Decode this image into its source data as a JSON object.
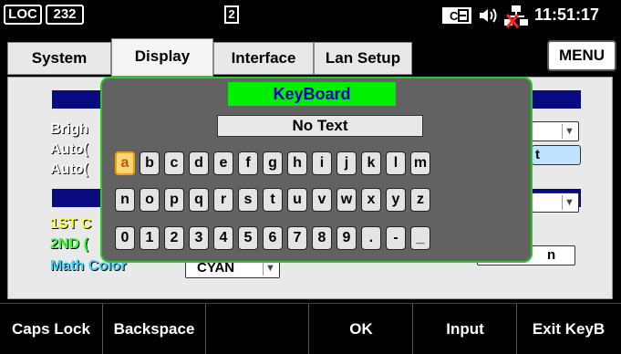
{
  "status": {
    "loc": "LOC",
    "addr": "232",
    "page_indicator": "2",
    "clock": "11:51:17",
    "icons": [
      "ce-icon",
      "speaker-icon",
      "network-disconnected-icon"
    ]
  },
  "tabs": [
    {
      "label": "System"
    },
    {
      "label": "Display"
    },
    {
      "label": "Interface"
    },
    {
      "label": "Lan Setup"
    }
  ],
  "menu_label": "MENU",
  "panel": {
    "labels": {
      "brightness": "Brigh",
      "auto1": "Auto(",
      "auto2": "Auto(",
      "first_color": "1ST C",
      "second_color": "2ND (",
      "math_color": "Math Color"
    },
    "math_color_value": "CYAN",
    "right_button_partial": "t",
    "right_button2_partial": "n"
  },
  "keyboard": {
    "title": "KeyBoard",
    "text_value": "No Text",
    "selected": "a",
    "rows": [
      [
        "a",
        "b",
        "c",
        "d",
        "e",
        "f",
        "g",
        "h",
        "i",
        "j",
        "k",
        "l",
        "m"
      ],
      [
        "n",
        "o",
        "p",
        "q",
        "r",
        "s",
        "t",
        "u",
        "v",
        "w",
        "x",
        "y",
        "z"
      ],
      [
        "0",
        "1",
        "2",
        "3",
        "4",
        "5",
        "6",
        "7",
        "8",
        "9",
        ".",
        "-",
        "_"
      ]
    ]
  },
  "softkeys": [
    {
      "label": "Caps Lock"
    },
    {
      "label": "Backspace"
    },
    {
      "label": ""
    },
    {
      "label": "OK"
    },
    {
      "label": "Input"
    },
    {
      "label": "Exit KeyB"
    }
  ],
  "colors": {
    "dialog_border": "#2bc62b",
    "dialog_title_bg": "#00ee00",
    "dialog_title_text": "#0000c0",
    "panel_bg": "#e9e9e9",
    "bluebar": "#0a0a80"
  }
}
